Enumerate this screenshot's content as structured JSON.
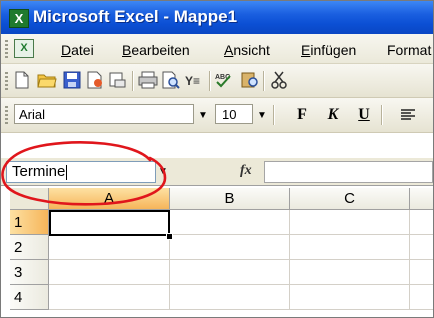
{
  "window": {
    "title": "Microsoft Excel - Mappe1",
    "app_icon_glyph": "X"
  },
  "menu": {
    "items": [
      {
        "label": "Datei",
        "mnemonic": "D",
        "rest": "atei"
      },
      {
        "label": "Bearbeiten",
        "mnemonic": "B",
        "rest": "earbeiten"
      },
      {
        "label": "Ansicht",
        "mnemonic": "A",
        "rest": "nsicht"
      },
      {
        "label": "Einfügen",
        "mnemonic": "E",
        "rest": "infügen"
      },
      {
        "label": "Format",
        "mnemonic": "",
        "rest": "Format"
      }
    ]
  },
  "standard_toolbar": {
    "icons": [
      "new-document-icon",
      "open-folder-icon",
      "save-icon",
      "permission-icon",
      "print-preview-icon",
      "print-icon",
      "preview-icon",
      "research-icon",
      "spelling-icon",
      "research-book-icon",
      "cut-icon"
    ]
  },
  "format_toolbar": {
    "font": "Arial",
    "size": "10",
    "bold": "F",
    "italic": "K",
    "underline": "U"
  },
  "formula_bar": {
    "name_box_value": "Termine",
    "fx_label": "fx",
    "formula_value": ""
  },
  "sheet": {
    "columns": [
      "A",
      "B",
      "C"
    ],
    "rows": [
      "1",
      "2",
      "3",
      "4"
    ],
    "active_cell": "A1"
  },
  "colors": {
    "title_bar": "#0a47c4",
    "highlight_ellipse": "#e0161c",
    "selected_header": "#f6b55a"
  }
}
